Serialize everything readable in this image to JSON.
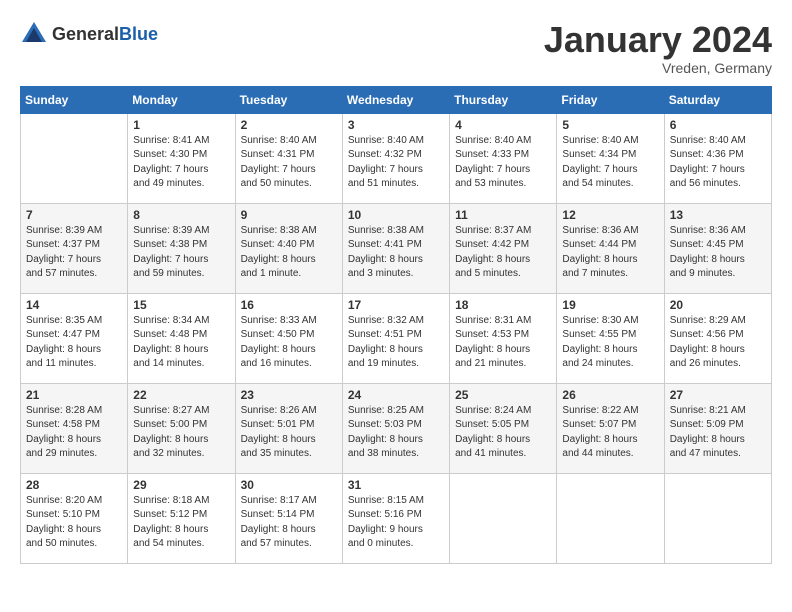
{
  "header": {
    "logo_general": "General",
    "logo_blue": "Blue",
    "month_title": "January 2024",
    "subtitle": "Vreden, Germany"
  },
  "days_of_week": [
    "Sunday",
    "Monday",
    "Tuesday",
    "Wednesday",
    "Thursday",
    "Friday",
    "Saturday"
  ],
  "weeks": [
    [
      {
        "day": "",
        "content": ""
      },
      {
        "day": "1",
        "content": "Sunrise: 8:41 AM\nSunset: 4:30 PM\nDaylight: 7 hours\nand 49 minutes."
      },
      {
        "day": "2",
        "content": "Sunrise: 8:40 AM\nSunset: 4:31 PM\nDaylight: 7 hours\nand 50 minutes."
      },
      {
        "day": "3",
        "content": "Sunrise: 8:40 AM\nSunset: 4:32 PM\nDaylight: 7 hours\nand 51 minutes."
      },
      {
        "day": "4",
        "content": "Sunrise: 8:40 AM\nSunset: 4:33 PM\nDaylight: 7 hours\nand 53 minutes."
      },
      {
        "day": "5",
        "content": "Sunrise: 8:40 AM\nSunset: 4:34 PM\nDaylight: 7 hours\nand 54 minutes."
      },
      {
        "day": "6",
        "content": "Sunrise: 8:40 AM\nSunset: 4:36 PM\nDaylight: 7 hours\nand 56 minutes."
      }
    ],
    [
      {
        "day": "7",
        "content": "Sunrise: 8:39 AM\nSunset: 4:37 PM\nDaylight: 7 hours\nand 57 minutes."
      },
      {
        "day": "8",
        "content": "Sunrise: 8:39 AM\nSunset: 4:38 PM\nDaylight: 7 hours\nand 59 minutes."
      },
      {
        "day": "9",
        "content": "Sunrise: 8:38 AM\nSunset: 4:40 PM\nDaylight: 8 hours\nand 1 minute."
      },
      {
        "day": "10",
        "content": "Sunrise: 8:38 AM\nSunset: 4:41 PM\nDaylight: 8 hours\nand 3 minutes."
      },
      {
        "day": "11",
        "content": "Sunrise: 8:37 AM\nSunset: 4:42 PM\nDaylight: 8 hours\nand 5 minutes."
      },
      {
        "day": "12",
        "content": "Sunrise: 8:36 AM\nSunset: 4:44 PM\nDaylight: 8 hours\nand 7 minutes."
      },
      {
        "day": "13",
        "content": "Sunrise: 8:36 AM\nSunset: 4:45 PM\nDaylight: 8 hours\nand 9 minutes."
      }
    ],
    [
      {
        "day": "14",
        "content": "Sunrise: 8:35 AM\nSunset: 4:47 PM\nDaylight: 8 hours\nand 11 minutes."
      },
      {
        "day": "15",
        "content": "Sunrise: 8:34 AM\nSunset: 4:48 PM\nDaylight: 8 hours\nand 14 minutes."
      },
      {
        "day": "16",
        "content": "Sunrise: 8:33 AM\nSunset: 4:50 PM\nDaylight: 8 hours\nand 16 minutes."
      },
      {
        "day": "17",
        "content": "Sunrise: 8:32 AM\nSunset: 4:51 PM\nDaylight: 8 hours\nand 19 minutes."
      },
      {
        "day": "18",
        "content": "Sunrise: 8:31 AM\nSunset: 4:53 PM\nDaylight: 8 hours\nand 21 minutes."
      },
      {
        "day": "19",
        "content": "Sunrise: 8:30 AM\nSunset: 4:55 PM\nDaylight: 8 hours\nand 24 minutes."
      },
      {
        "day": "20",
        "content": "Sunrise: 8:29 AM\nSunset: 4:56 PM\nDaylight: 8 hours\nand 26 minutes."
      }
    ],
    [
      {
        "day": "21",
        "content": "Sunrise: 8:28 AM\nSunset: 4:58 PM\nDaylight: 8 hours\nand 29 minutes."
      },
      {
        "day": "22",
        "content": "Sunrise: 8:27 AM\nSunset: 5:00 PM\nDaylight: 8 hours\nand 32 minutes."
      },
      {
        "day": "23",
        "content": "Sunrise: 8:26 AM\nSunset: 5:01 PM\nDaylight: 8 hours\nand 35 minutes."
      },
      {
        "day": "24",
        "content": "Sunrise: 8:25 AM\nSunset: 5:03 PM\nDaylight: 8 hours\nand 38 minutes."
      },
      {
        "day": "25",
        "content": "Sunrise: 8:24 AM\nSunset: 5:05 PM\nDaylight: 8 hours\nand 41 minutes."
      },
      {
        "day": "26",
        "content": "Sunrise: 8:22 AM\nSunset: 5:07 PM\nDaylight: 8 hours\nand 44 minutes."
      },
      {
        "day": "27",
        "content": "Sunrise: 8:21 AM\nSunset: 5:09 PM\nDaylight: 8 hours\nand 47 minutes."
      }
    ],
    [
      {
        "day": "28",
        "content": "Sunrise: 8:20 AM\nSunset: 5:10 PM\nDaylight: 8 hours\nand 50 minutes."
      },
      {
        "day": "29",
        "content": "Sunrise: 8:18 AM\nSunset: 5:12 PM\nDaylight: 8 hours\nand 54 minutes."
      },
      {
        "day": "30",
        "content": "Sunrise: 8:17 AM\nSunset: 5:14 PM\nDaylight: 8 hours\nand 57 minutes."
      },
      {
        "day": "31",
        "content": "Sunrise: 8:15 AM\nSunset: 5:16 PM\nDaylight: 9 hours\nand 0 minutes."
      },
      {
        "day": "",
        "content": ""
      },
      {
        "day": "",
        "content": ""
      },
      {
        "day": "",
        "content": ""
      }
    ]
  ]
}
